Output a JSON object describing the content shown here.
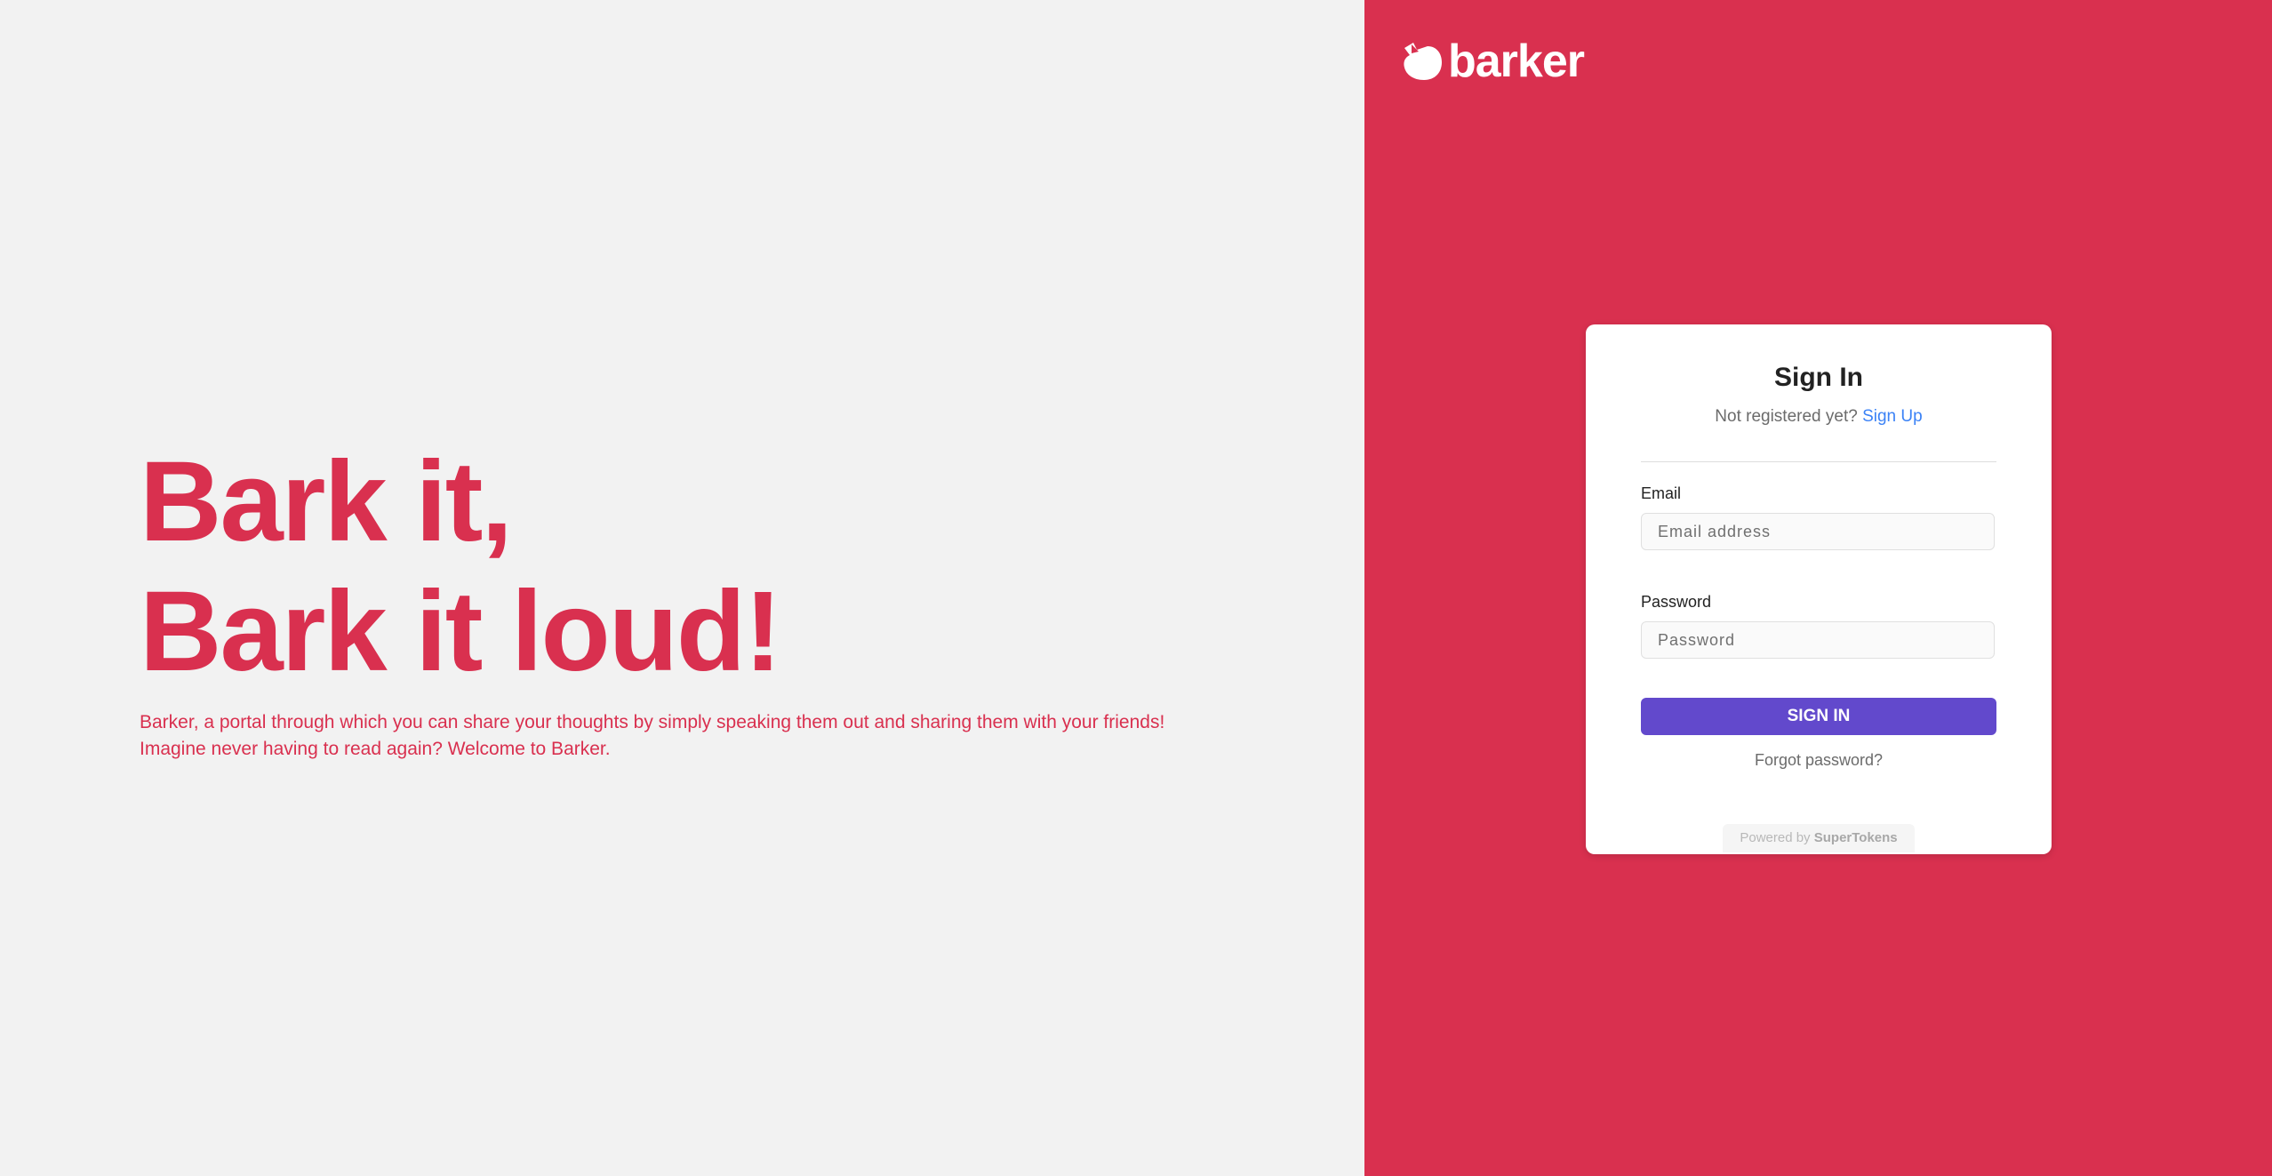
{
  "hero": {
    "headline_line1": "Bark it,",
    "headline_line2": "Bark it loud!",
    "tagline_line1": "Barker, a portal through which you can share your thoughts by simply speaking them out and sharing them with your friends!",
    "tagline_line2": "Imagine never having to read again? Welcome to Barker."
  },
  "brand": {
    "logo_text": "barker",
    "logo_icon": "barker-dog-icon",
    "primary_color": "#d9304f",
    "button_color": "#6249cc",
    "link_color": "#3b82f6"
  },
  "signin": {
    "title": "Sign In",
    "subtitle": "Not registered yet?",
    "signup_link": "Sign Up",
    "email_label": "Email",
    "email_placeholder": "Email address",
    "password_label": "Password",
    "password_placeholder": "Password",
    "submit_label": "SIGN IN",
    "forgot_label": "Forgot password?",
    "powered_prefix": "Powered by",
    "powered_brand": "SuperTokens"
  }
}
